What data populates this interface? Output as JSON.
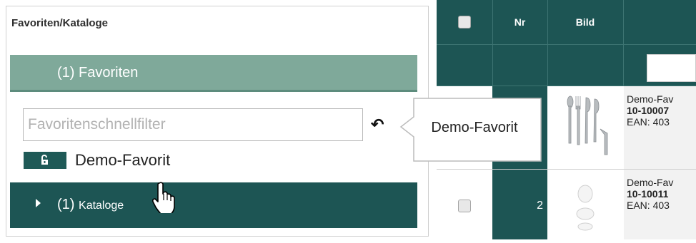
{
  "panel": {
    "title": "Favoriten/Kataloge",
    "favorites_header": "(1) Favoriten",
    "filter_placeholder": "Favoritenschnellfilter",
    "favorite_item": "Demo-Favorit",
    "catalog_header_count": "(1)",
    "catalog_header_label": "Kataloge"
  },
  "tooltip": {
    "text": "Demo-Favorit"
  },
  "table": {
    "columns": [
      "",
      "Nr",
      "Bild"
    ],
    "rows": [
      {
        "nr": "",
        "name": "Demo-Fav",
        "sku": "10-10007",
        "ean": "EAN: 403"
      },
      {
        "nr": "2",
        "name": "Demo-Fav",
        "sku": "10-10011",
        "ean": "EAN: 403"
      }
    ]
  },
  "icons": [
    "lock-open-icon",
    "undo-icon",
    "caret-right-icon",
    "hand-cursor-icon",
    "checkbox-icon"
  ],
  "colors": {
    "dark_teal": "#1d5554",
    "light_teal": "#7fa99a"
  }
}
